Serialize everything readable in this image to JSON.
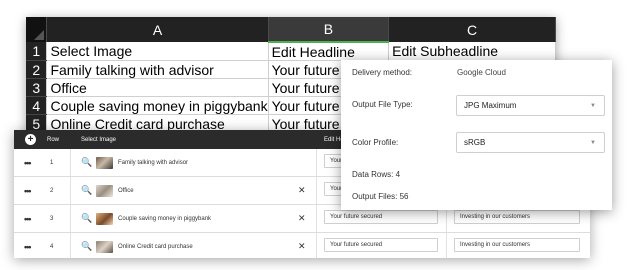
{
  "sheet": {
    "columns": [
      "A",
      "B",
      "C"
    ],
    "rows": [
      {
        "num": "1",
        "a": "Select Image",
        "b": "Edit Headline",
        "c": "Edit Subheadline"
      },
      {
        "num": "2",
        "a": "Family talking with advisor",
        "b": "Your future secu",
        "c": ""
      },
      {
        "num": "3",
        "a": "Office",
        "b": "Your future secu",
        "c": ""
      },
      {
        "num": "4",
        "a": "Couple saving money in piggybank",
        "b": "Your future secu",
        "c": ""
      },
      {
        "num": "5",
        "a": "Online Credit card purchase",
        "b": "Your future secu",
        "c": ""
      }
    ]
  },
  "app": {
    "header": {
      "add_icon": "+",
      "row": "Row",
      "select_image": "Select Image",
      "edit_headline": "Edit He"
    },
    "rows": [
      {
        "num": "1",
        "image_label": "Family talking with advisor",
        "headline": "Your f",
        "subheadline": "",
        "show_x": false
      },
      {
        "num": "2",
        "image_label": "Office",
        "headline": "Your f",
        "subheadline": "",
        "show_x": true
      },
      {
        "num": "3",
        "image_label": "Couple saving money in piggybank",
        "headline": "Your future secured",
        "subheadline": "Investing in our customers",
        "show_x": true
      },
      {
        "num": "4",
        "image_label": "Online Credit card purchase",
        "headline": "Your future secured",
        "subheadline": "Investing in our customers",
        "show_x": true
      }
    ],
    "row_menu": "•••",
    "search_glyph": "🔍",
    "remove_glyph": "✕"
  },
  "popup": {
    "delivery_label": "Delivery method:",
    "delivery_value": "Google Cloud",
    "file_type_label": "Output File Type:",
    "file_type_value": "JPG Maximum",
    "color_label": "Color Profile:",
    "color_value": "sRGB",
    "data_rows": "Data Rows: 4",
    "output_files": "Output Files: 56",
    "caret": "▼"
  },
  "colors": {
    "sheet_header": "#222222",
    "app_header": "#2b2b2b",
    "selected_column_accent": "#4caf50"
  }
}
